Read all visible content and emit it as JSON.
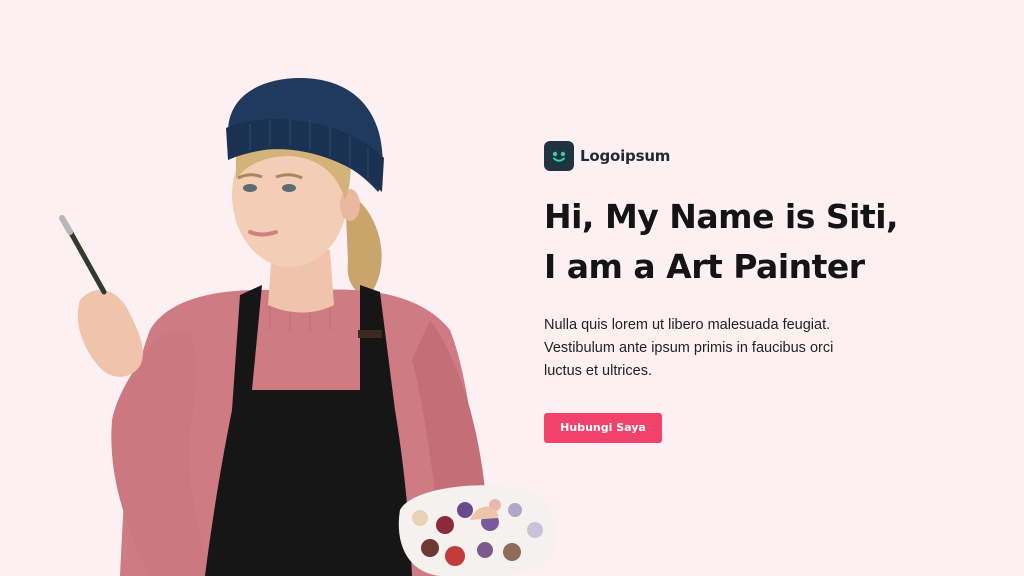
{
  "brand": {
    "name": "Logoipsum",
    "icon": "smiley-face-icon",
    "mark_color": "#1f3440",
    "accent_color": "#2ed3a6"
  },
  "hero": {
    "headline_line1": "Hi, My Name is Siti,",
    "headline_line2": "I am a Art Painter",
    "description_line1": "Nulla quis lorem ut libero malesuada feugiat.",
    "description_line2": "Vestibulum ante ipsum primis in faucibus orci",
    "description_line3": "luctus et ultrices.",
    "cta_label": "Hubungi Saya",
    "cta_color": "#f0426b",
    "background_color": "#fdf0f3"
  }
}
